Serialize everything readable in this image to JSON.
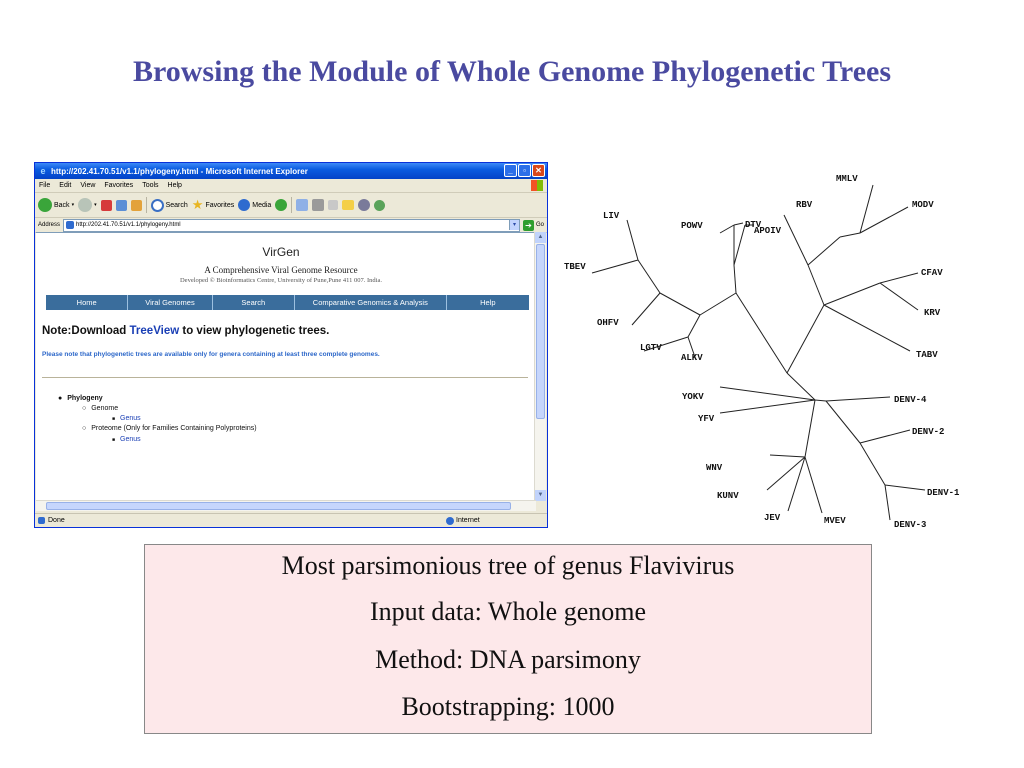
{
  "slide": {
    "title": "Browsing the Module of Whole Genome Phylogenetic Trees"
  },
  "browser": {
    "window_title": "http://202.41.70.51/v1.1/phylogeny.html - Microsoft Internet Explorer",
    "menu": [
      "File",
      "Edit",
      "View",
      "Favorites",
      "Tools",
      "Help"
    ],
    "toolbar": {
      "back": "Back",
      "search": "Search",
      "favorites": "Favorites",
      "media": "Media"
    },
    "address_label": "Address",
    "address_value": "http://202.41.70.51/v1.1/phylogeny.html",
    "go_label": "Go",
    "status_text": "Done",
    "zone_text": "Internet"
  },
  "page": {
    "site_title": "VirGen",
    "subtitle": "A Comprehensive Viral Genome Resource",
    "credit": "Developed © Bioinformatics Centre, University of Pune,Pune 411 007. India.",
    "nav": [
      "Home",
      "Viral Genomes",
      "Search",
      "Comparative Genomics & Analysis",
      "Help"
    ],
    "note_prefix": "Note:Download ",
    "note_link": "TreeView",
    "note_suffix": " to view phylogenetic trees.",
    "info": "Please note that phylogenetic trees are  available only for genera containing at least three complete genomes.",
    "tree": {
      "root": "Phylogeny",
      "genome": "Genome",
      "genome_genus": "Genus",
      "proteome": "Proteome (Only for Families Containing Polyproteins)",
      "proteome_genus": "Genus"
    }
  },
  "phylogeny": {
    "labels": [
      "MMLV",
      "MODV",
      "RBV",
      "DTV",
      "APOIV",
      "POWV",
      "LIV",
      "TBEV",
      "OHFV",
      "LGTV",
      "ALKV",
      "CFAV",
      "KRV",
      "TABV",
      "YOKV",
      "YFV",
      "DENV-4",
      "DENV-2",
      "DENV-1",
      "DENV-3",
      "WNV",
      "KUNV",
      "JEV",
      "MVEV"
    ]
  },
  "caption": {
    "line1": "Most parsimonious tree of genus Flavivirus",
    "line2": "Input data: Whole genome",
    "line3": "Method: DNA parsimony",
    "line4": "Bootstrapping: 1000"
  }
}
